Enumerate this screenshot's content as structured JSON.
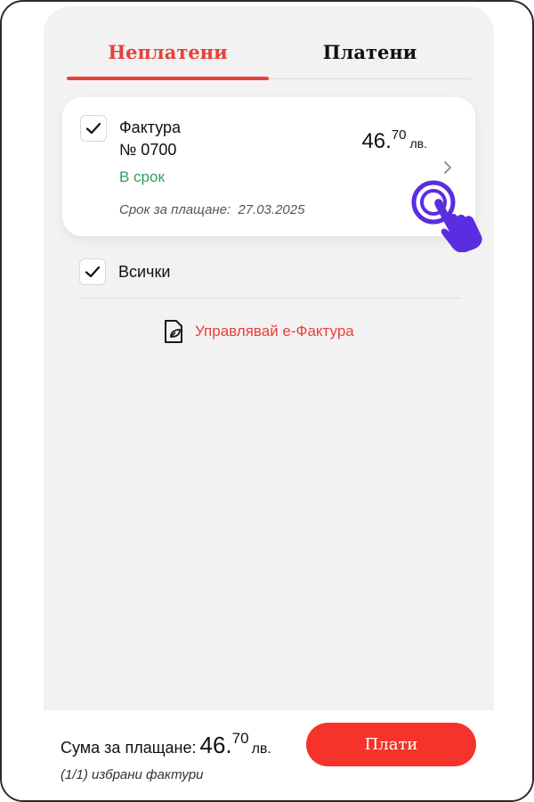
{
  "tabs": [
    {
      "label": "Неплатени",
      "active": true
    },
    {
      "label": "Платени",
      "active": false
    }
  ],
  "invoice": {
    "checked": true,
    "title_line1": "Фактура",
    "title_line2": "№ 0700",
    "status": "В срок",
    "due_label": "Срок за плащане:",
    "due_date": "27.03.2025",
    "amount_int": "46.",
    "amount_dec": "70",
    "currency": "лв.",
    "icon": "chevron-right-icon"
  },
  "select_all": {
    "label": "Всички",
    "checked": true
  },
  "einvoice": {
    "label": "УправлявайЕ е-Фактура",
    "icon": "document-leaf-icon"
  },
  "footer": {
    "sum_label": "Сума за плащане:",
    "amount_int": "46.",
    "amount_dec": "70",
    "currency": "лв.",
    "selected_count": "(1/1) избрани фактури",
    "pay_label": "Плати"
  },
  "colors": {
    "accent": "#e8403a",
    "pay_button": "#f5332b",
    "status_ok": "#2e9e5b",
    "hand_cursor": "#5b2de0",
    "background": "#f2f2f2"
  }
}
